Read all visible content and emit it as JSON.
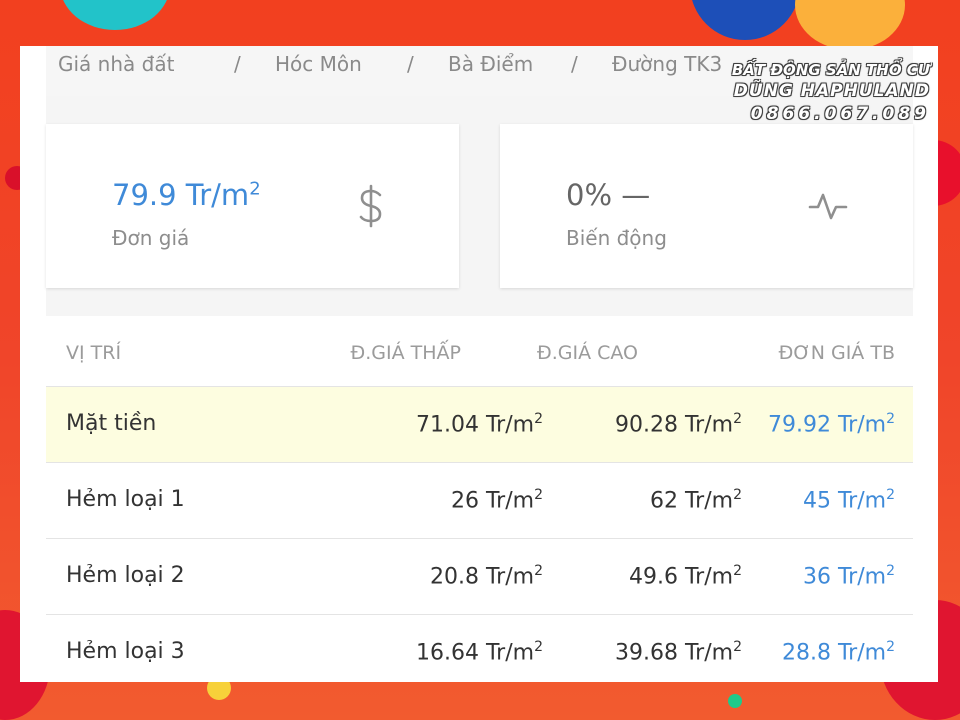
{
  "breadcrumb": [
    {
      "label": "Giá nhà đất"
    },
    {
      "label": "Hóc Môn"
    },
    {
      "label": "Bà Điểm"
    },
    {
      "label": "Đường TK3"
    }
  ],
  "breadcrumb_separator": "/",
  "stats": {
    "unit_price": {
      "value": "79.9 Tr/m",
      "superscript": "2",
      "label": "Đơn giá",
      "icon": "dollar-icon",
      "color": "#3f8ad8"
    },
    "change": {
      "value": "0% —",
      "label": "Biến động",
      "icon": "activity-icon",
      "color": "#666666"
    }
  },
  "table": {
    "headers": {
      "location": "VỊ TRÍ",
      "low": "Đ.GIÁ THẤP",
      "high": "Đ.GIÁ CAO",
      "avg": "ĐƠN GIÁ TB"
    },
    "rows": [
      {
        "location": "Mặt tiền",
        "low": "71.04 Tr/m",
        "high": "90.28 Tr/m",
        "avg": "79.92 Tr/m",
        "sup": "2",
        "highlighted": true
      },
      {
        "location": "Hẻm loại 1",
        "low": "26 Tr/m",
        "high": "62 Tr/m",
        "avg": "45 Tr/m",
        "sup": "2",
        "highlighted": false
      },
      {
        "location": "Hẻm loại 2",
        "low": "20.8 Tr/m",
        "high": "49.6 Tr/m",
        "avg": "36 Tr/m",
        "sup": "2",
        "highlighted": false
      },
      {
        "location": "Hẻm loại 3",
        "low": "16.64 Tr/m",
        "high": "39.68 Tr/m",
        "avg": "28.8 Tr/m",
        "sup": "2",
        "highlighted": false
      }
    ]
  },
  "watermark": {
    "line1": "BẤT ĐỘNG SẢN THỔ CƯ",
    "line2": "DŨNG HAPHULAND",
    "line3": "0866.067.089"
  },
  "colors": {
    "accent": "#3f8ad8",
    "highlight_row": "#fdfde0",
    "background": "#f2401f"
  }
}
